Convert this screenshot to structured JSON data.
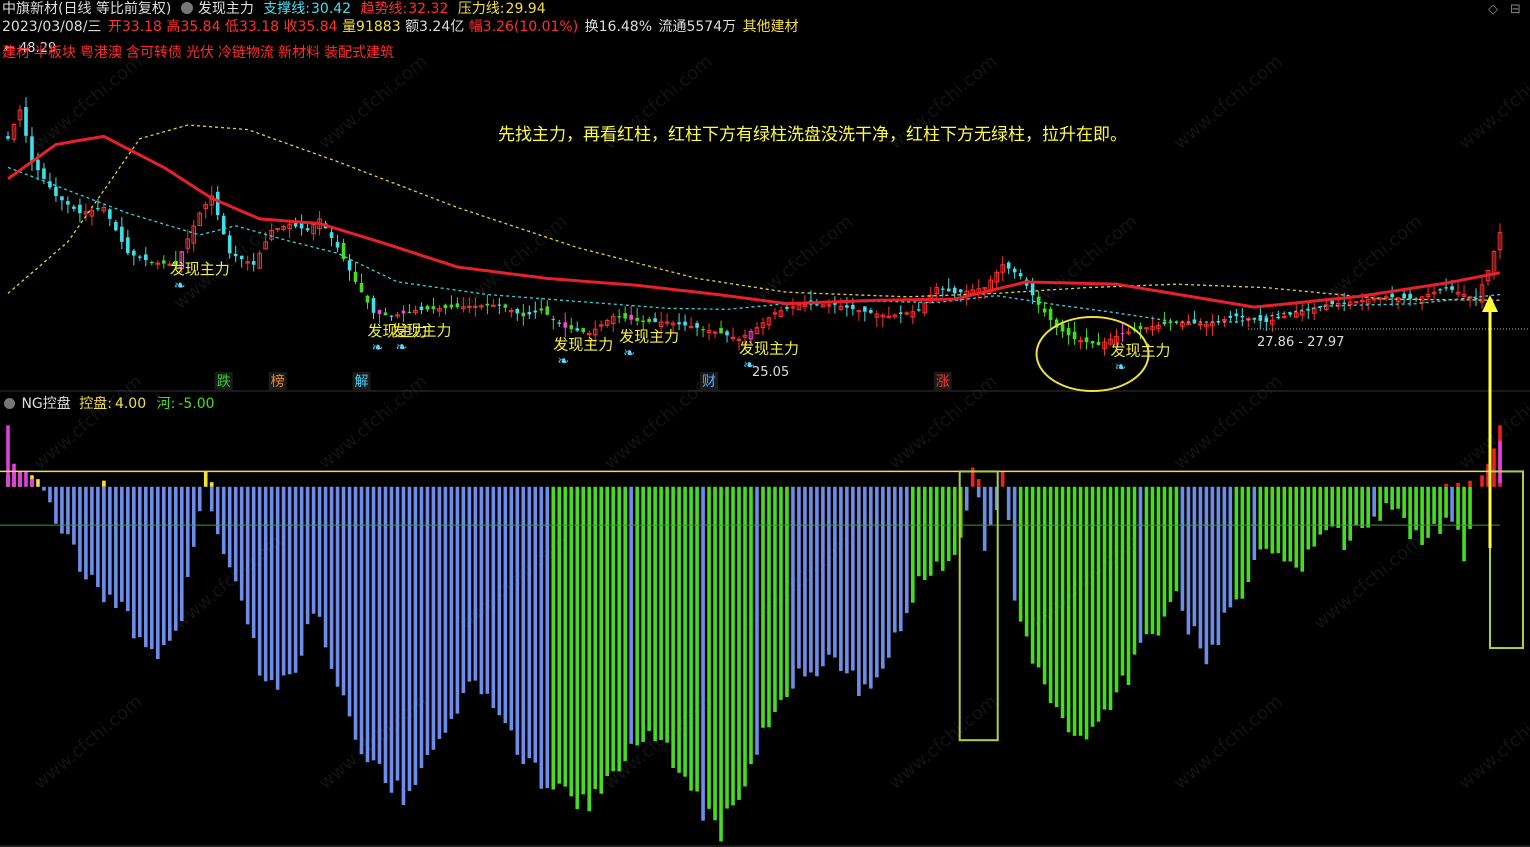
{
  "header": {
    "stock_name": "中旗新材",
    "period_label": "(日线 等比前复权)",
    "indicator_name": "发现主力",
    "support_label": "支撑线:",
    "support_value": "30.42",
    "trend_label": "趋势线:",
    "trend_value": "32.32",
    "pressure_label": "压力线:",
    "pressure_value": "29.94",
    "date": "2023/03/08/三",
    "open": "开33.18",
    "high": "高35.84",
    "low": "低33.18",
    "close": "收35.84",
    "volume": "量91883",
    "amount": "额3.24亿",
    "change": "幅3.26(10.01%)",
    "turnover": "换16.48%",
    "float": "流通5574万",
    "industry": "其他建材",
    "concepts": [
      "建材",
      "半板块",
      "粤港澳",
      "含可转债",
      "光伏",
      "冷链物流",
      "新材料",
      "装配式建筑"
    ]
  },
  "indicator_header": {
    "name": "NG控盘",
    "kong_label": "控盘:",
    "kong_value": "4.00",
    "he_label": "河:",
    "he_value": "-5.00"
  },
  "annotation": "先找主力，再看红柱，红柱下方有绿柱洗盘没洗干净，红柱下方无绿柱，拉升在即。",
  "window_controls": [
    "◇",
    "⊟"
  ],
  "colors": {
    "up": "#ff3030",
    "down": "#40e0e8",
    "signal_up": "#44dd22",
    "ma_red": "#e8202a",
    "ma_yellow": "#e0d040",
    "ma_cyan": "#3ad0e0",
    "hist_blue": "#6c8ee8",
    "hist_green": "#44dd22",
    "hist_red": "#ee2020",
    "hist_yellow": "#f0e040",
    "hist_magenta": "#e040e0",
    "annot_yellow": "#ffff3c"
  },
  "chart_data": [
    {
      "type": "candlestick",
      "title": "中旗新材(日线 等比前复权)",
      "price_labels": [
        "48.29",
        "25.05",
        "27.86 - 27.97"
      ],
      "ylim": [
        22.5,
        50
      ],
      "series": [
        {
          "name": "支撑线",
          "values_last": 30.42
        },
        {
          "name": "趋势线",
          "values_last": 32.32
        },
        {
          "name": "压力线",
          "values_last": 29.94
        }
      ],
      "signal_label": "发现主力",
      "signal_bar_indices": [
        29,
        62,
        66,
        93,
        104,
        124,
        186
      ],
      "event_markers": [
        {
          "text": "跌",
          "bar": 36,
          "color": "#33cc33"
        },
        {
          "text": "榜",
          "bar": 45,
          "color": "#ee8822"
        },
        {
          "text": "解",
          "bar": 59,
          "color": "#44ccee"
        },
        {
          "text": "财",
          "bar": 117,
          "color": "#55aaff"
        },
        {
          "text": "涨",
          "bar": 156,
          "color": "#ff3333"
        }
      ],
      "trend_anchors": [
        [
          0,
          40.5
        ],
        [
          8,
          43.5
        ],
        [
          16,
          44.2
        ],
        [
          26,
          41.5
        ],
        [
          34,
          38.8
        ],
        [
          42,
          37.0
        ],
        [
          52,
          36.6
        ],
        [
          62,
          35.0
        ],
        [
          75,
          32.8
        ],
        [
          90,
          31.8
        ],
        [
          105,
          31.2
        ],
        [
          120,
          30.3
        ],
        [
          130,
          29.6
        ],
        [
          145,
          29.9
        ],
        [
          158,
          30.0
        ],
        [
          170,
          31.5
        ],
        [
          185,
          31.3
        ],
        [
          200,
          30.0
        ],
        [
          208,
          29.3
        ],
        [
          225,
          30.2
        ],
        [
          240,
          31.4
        ],
        [
          249,
          32.3
        ]
      ],
      "pressure_anchors": [
        [
          0,
          30.5
        ],
        [
          10,
          35.0
        ],
        [
          22,
          44.0
        ],
        [
          30,
          45.2
        ],
        [
          40,
          44.8
        ],
        [
          55,
          42.0
        ],
        [
          75,
          38.0
        ],
        [
          95,
          34.5
        ],
        [
          115,
          31.8
        ],
        [
          130,
          30.6
        ],
        [
          150,
          30.2
        ],
        [
          165,
          30.5
        ],
        [
          180,
          31.0
        ],
        [
          195,
          31.3
        ],
        [
          210,
          31.0
        ],
        [
          230,
          30.0
        ],
        [
          249,
          29.9
        ]
      ],
      "support_anchors": [
        [
          0,
          41.5
        ],
        [
          10,
          39.5
        ],
        [
          20,
          37.5
        ],
        [
          32,
          35.6
        ],
        [
          38,
          36.4
        ],
        [
          46,
          35.2
        ],
        [
          55,
          34.0
        ],
        [
          65,
          31.5
        ],
        [
          80,
          30.4
        ],
        [
          95,
          29.8
        ],
        [
          110,
          29.2
        ],
        [
          120,
          29.1
        ],
        [
          130,
          29.6
        ],
        [
          145,
          29.8
        ],
        [
          155,
          29.7
        ],
        [
          165,
          30.3
        ],
        [
          175,
          29.5
        ],
        [
          185,
          28.8
        ],
        [
          195,
          28.0
        ],
        [
          205,
          28.0
        ],
        [
          220,
          29.4
        ],
        [
          235,
          29.6
        ],
        [
          249,
          30.4
        ]
      ],
      "close_anchors": [
        [
          0,
          44.0
        ],
        [
          2,
          46.5
        ],
        [
          4,
          42.0
        ],
        [
          8,
          39.0
        ],
        [
          12,
          37.5
        ],
        [
          16,
          38.0
        ],
        [
          20,
          34.0
        ],
        [
          24,
          33.2
        ],
        [
          28,
          33.0
        ],
        [
          32,
          37.5
        ],
        [
          34,
          39.0
        ],
        [
          37,
          34.0
        ],
        [
          41,
          33.0
        ],
        [
          44,
          36.0
        ],
        [
          47,
          36.5
        ],
        [
          50,
          36.0
        ],
        [
          52,
          37.0
        ],
        [
          55,
          34.5
        ],
        [
          58,
          31.5
        ],
        [
          61,
          28.8
        ],
        [
          64,
          28.5
        ],
        [
          68,
          29.0
        ],
        [
          75,
          29.3
        ],
        [
          82,
          29.5
        ],
        [
          86,
          28.5
        ],
        [
          89,
          29.0
        ],
        [
          93,
          27.5
        ],
        [
          97,
          27.0
        ],
        [
          101,
          28.5
        ],
        [
          106,
          28.0
        ],
        [
          110,
          28.0
        ],
        [
          115,
          27.5
        ],
        [
          119,
          27.0
        ],
        [
          122,
          26.5
        ],
        [
          125,
          27.5
        ],
        [
          128,
          28.8
        ],
        [
          132,
          29.5
        ],
        [
          138,
          29.5
        ],
        [
          142,
          29.0
        ],
        [
          147,
          28.5
        ],
        [
          152,
          29.0
        ],
        [
          155,
          31.0
        ],
        [
          158,
          30.5
        ],
        [
          163,
          31.0
        ],
        [
          166,
          33.0
        ],
        [
          169,
          32.0
        ],
        [
          172,
          29.5
        ],
        [
          175,
          27.5
        ],
        [
          178,
          26.5
        ],
        [
          182,
          26.0
        ],
        [
          186,
          27.0
        ],
        [
          190,
          27.5
        ],
        [
          195,
          28.0
        ],
        [
          200,
          27.8
        ],
        [
          205,
          28.5
        ],
        [
          210,
          28.0
        ],
        [
          215,
          28.8
        ],
        [
          220,
          29.5
        ],
        [
          225,
          29.8
        ],
        [
          230,
          30.2
        ],
        [
          235,
          30.0
        ],
        [
          240,
          31.0
        ],
        [
          245,
          30.0
        ],
        [
          247,
          32.5
        ],
        [
          249,
          35.8
        ]
      ]
    },
    {
      "type": "bar",
      "title": "NG控盘",
      "series": [
        {
          "name": "控盘",
          "value_last": 4.0
        },
        {
          "name": "河",
          "value_last": -5.0
        }
      ],
      "hist_anchors": [
        [
          0,
          9
        ],
        [
          2,
          3
        ],
        [
          4,
          2
        ],
        [
          6,
          -1
        ],
        [
          8,
          -4
        ],
        [
          12,
          -10
        ],
        [
          16,
          -14
        ],
        [
          20,
          -17
        ],
        [
          24,
          -22
        ],
        [
          28,
          -20
        ],
        [
          30,
          -12
        ],
        [
          33,
          0.8
        ],
        [
          35,
          -5
        ],
        [
          38,
          -12
        ],
        [
          42,
          -24
        ],
        [
          45,
          -27
        ],
        [
          48,
          -23
        ],
        [
          51,
          -16
        ],
        [
          54,
          -23
        ],
        [
          58,
          -33
        ],
        [
          62,
          -36
        ],
        [
          66,
          -41
        ],
        [
          70,
          -36
        ],
        [
          74,
          -30
        ],
        [
          78,
          -25
        ],
        [
          82,
          -30
        ],
        [
          86,
          -35
        ],
        [
          89,
          -38
        ],
        [
          93,
          -40
        ],
        [
          97,
          -42
        ],
        [
          101,
          -37
        ],
        [
          104,
          -34
        ],
        [
          108,
          -33
        ],
        [
          112,
          -36
        ],
        [
          116,
          -42
        ],
        [
          119,
          -45
        ],
        [
          122,
          -40
        ],
        [
          126,
          -32
        ],
        [
          130,
          -26
        ],
        [
          134,
          -24
        ],
        [
          138,
          -22
        ],
        [
          142,
          -26
        ],
        [
          146,
          -25
        ],
        [
          150,
          -15
        ],
        [
          154,
          -11
        ],
        [
          158,
          -9
        ],
        [
          160,
          -2
        ],
        [
          161,
          2.5
        ],
        [
          163,
          -8
        ],
        [
          165,
          -3
        ],
        [
          166,
          2.5
        ],
        [
          168,
          -14
        ],
        [
          171,
          -22
        ],
        [
          174,
          -27
        ],
        [
          178,
          -33
        ],
        [
          182,
          -30
        ],
        [
          186,
          -26
        ],
        [
          190,
          -20
        ],
        [
          195,
          -15
        ],
        [
          200,
          -22
        ],
        [
          205,
          -15
        ],
        [
          210,
          -8
        ],
        [
          215,
          -12
        ],
        [
          219,
          -6
        ],
        [
          223,
          -7
        ],
        [
          227,
          -4
        ],
        [
          231,
          -3
        ],
        [
          235,
          -7
        ],
        [
          238,
          -5
        ],
        [
          241,
          -4
        ],
        [
          243,
          -9
        ],
        [
          245,
          1
        ],
        [
          247,
          3
        ],
        [
          248,
          8
        ],
        [
          249,
          16
        ]
      ],
      "green_ranges": [
        [
          91,
          130
        ],
        [
          151,
          246
        ]
      ],
      "yellow_bars": [
        [
          0,
          1.5
        ],
        [
          1,
          2
        ],
        [
          2,
          2
        ],
        [
          4,
          1.5
        ],
        [
          5,
          1
        ],
        [
          16,
          0.8
        ],
        [
          33,
          2
        ],
        [
          34,
          0.6
        ]
      ],
      "magenta_bars": [
        [
          0,
          8
        ],
        [
          1,
          3
        ],
        [
          2,
          2
        ],
        [
          3,
          2
        ],
        [
          4,
          1
        ],
        [
          249,
          6
        ]
      ],
      "red_bars": [
        [
          161,
          2.5
        ],
        [
          162,
          1
        ],
        [
          166,
          2
        ],
        [
          240,
          0.4
        ],
        [
          242,
          0.5
        ],
        [
          244,
          0.8
        ],
        [
          246,
          1.5
        ],
        [
          247,
          3
        ],
        [
          248,
          5
        ],
        [
          249,
          8
        ]
      ],
      "levels": {
        "upper": 2.0,
        "zero": 0,
        "lower": -5.0
      },
      "ylim": [
        -46,
        10
      ]
    }
  ]
}
